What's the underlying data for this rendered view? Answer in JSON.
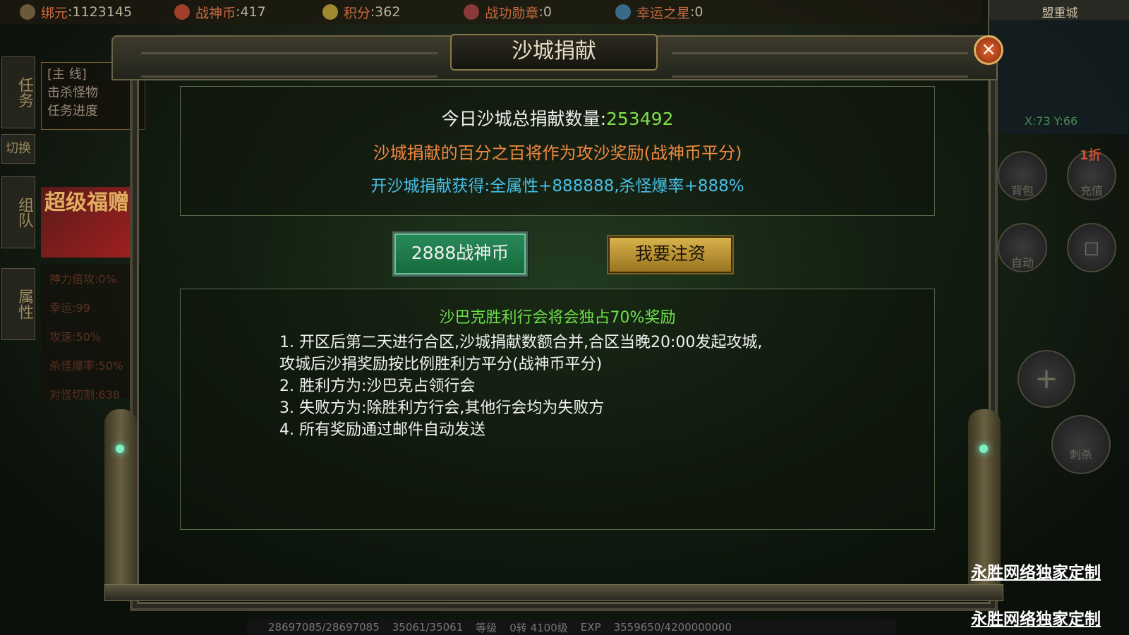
{
  "topbar": {
    "bind_gold_label": "绑元",
    "bind_gold_value": ":1123145",
    "war_coin_label": "战神币",
    "war_coin_value": ":417",
    "points_label": "积分",
    "points_value": ":362",
    "medal_label": "战功勋章",
    "medal_value": ":0",
    "lucky_star_label": "幸运之星",
    "lucky_star_value": ":0"
  },
  "map": {
    "city": "盟重城",
    "coord": "X:73 Y:66"
  },
  "left": {
    "tab_task": "任务",
    "tab_switch": "切换",
    "tab_team": "组队",
    "tab_attr": "属性",
    "quest_lines": [
      "[主 线]",
      "击杀怪物",
      "任务进度"
    ],
    "promo": "超级福赠",
    "stats": [
      "神力倍攻:0%",
      "幸运:99",
      "攻速:50%",
      "杀怪爆率:50%",
      "对怪切割:638"
    ]
  },
  "right": {
    "bag": "背包",
    "recharge": "充值",
    "auto": "自动",
    "discount": "1折",
    "kill": "刺杀"
  },
  "bottom": {
    "hp": "28697085/28697085",
    "mp": "35061/35061",
    "level_label": "等级",
    "level": "0转 4100级",
    "exp_label": "EXP",
    "exp": "3559650/4200000000"
  },
  "dialog": {
    "title": "沙城捐献",
    "close": "×",
    "total_label": "今日沙城总捐献数量:",
    "total_value": "253492",
    "note": "沙城捐献的百分之百将作为攻沙奖励(战神币平分)",
    "bonus": "开沙城捐献获得:全属性+888888,杀怪爆率+888%",
    "amount_button": "2888战神币",
    "donate_button": "我要注资",
    "reward_head": "沙巴克胜利行会将会独占70%奖励",
    "rules": [
      "1. 开区后第二天进行合区,沙城捐献数额合并,合区当晚20:00发起攻城,",
      "攻城后沙捐奖励按比例胜利方平分(战神币平分)",
      "2. 胜利方为:沙巴克占领行会",
      "3. 失败方为:除胜利方行会,其他行会均为失败方",
      "4. 所有奖励通过邮件自动发送"
    ]
  },
  "watermarks": [
    "永胜网络独家定制",
    "永胜网络独家定制"
  ],
  "colors": {
    "accent_green": "#7ee04a",
    "accent_orange": "#f08840",
    "accent_blue": "#48c0e8"
  }
}
